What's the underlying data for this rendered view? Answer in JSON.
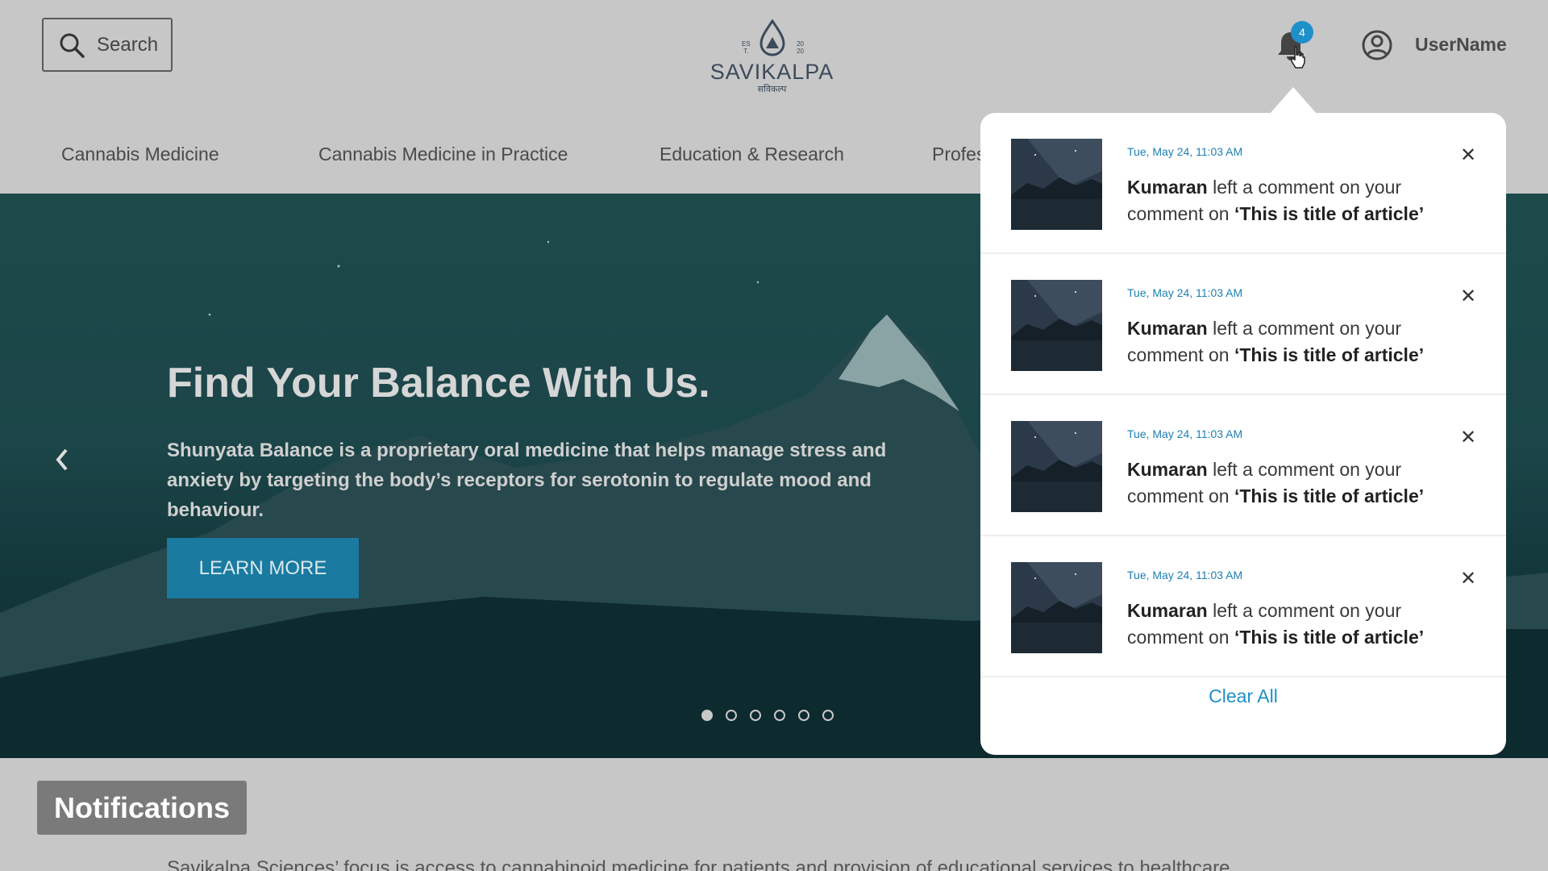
{
  "header": {
    "search_label": "Search",
    "logo": {
      "brand": "SAVIKALPA",
      "subtitle": "सविकल्प",
      "est_left": "ES\nT.",
      "est_right": "20\n20"
    },
    "notification_count": "4",
    "user_name": "UserName"
  },
  "nav": {
    "items": [
      {
        "label": "Cannabis Medicine"
      },
      {
        "label": "Cannabis Medicine in Practice"
      },
      {
        "label": "Education & Research"
      },
      {
        "label": "Profes"
      }
    ]
  },
  "hero": {
    "title": "Find Your Balance With Us.",
    "description": "Shunyata Balance is a proprietary oral medicine that helps manage stress and anxiety by targeting the body’s receptors for serotonin to regulate mood and behaviour.",
    "cta_label": "LEARN MORE",
    "slide_count": 6,
    "active_slide": 1
  },
  "notifications": {
    "items": [
      {
        "time": "Tue, May 24, 11:03 AM",
        "user": "Kumaran",
        "action": " left a comment on your comment on ",
        "article": "‘This is title of article’"
      },
      {
        "time": "Tue, May 24, 11:03 AM",
        "user": "Kumaran",
        "action": " left a comment on your comment on ",
        "article": "‘This is title of article’"
      },
      {
        "time": "Tue, May 24, 11:03 AM",
        "user": "Kumaran",
        "action": " left a comment on your comment on ",
        "article": "‘This is title of article’"
      },
      {
        "time": "Tue, May 24, 11:03 AM",
        "user": "Kumaran",
        "action": " left a comment on your comment on ",
        "article": "‘This is title of article’"
      }
    ],
    "close_glyph": "✕",
    "clear_all_label": "Clear All"
  },
  "section": {
    "heading": "Notifications",
    "intro": "Savikalpa Sciences’ focus is access to cannabinoid medicine for patients and provision of educational services to healthcare"
  },
  "colors": {
    "accent": "#1e8fc9",
    "cta": "#1a7aa0",
    "header_bg": "#c7c7c7"
  }
}
